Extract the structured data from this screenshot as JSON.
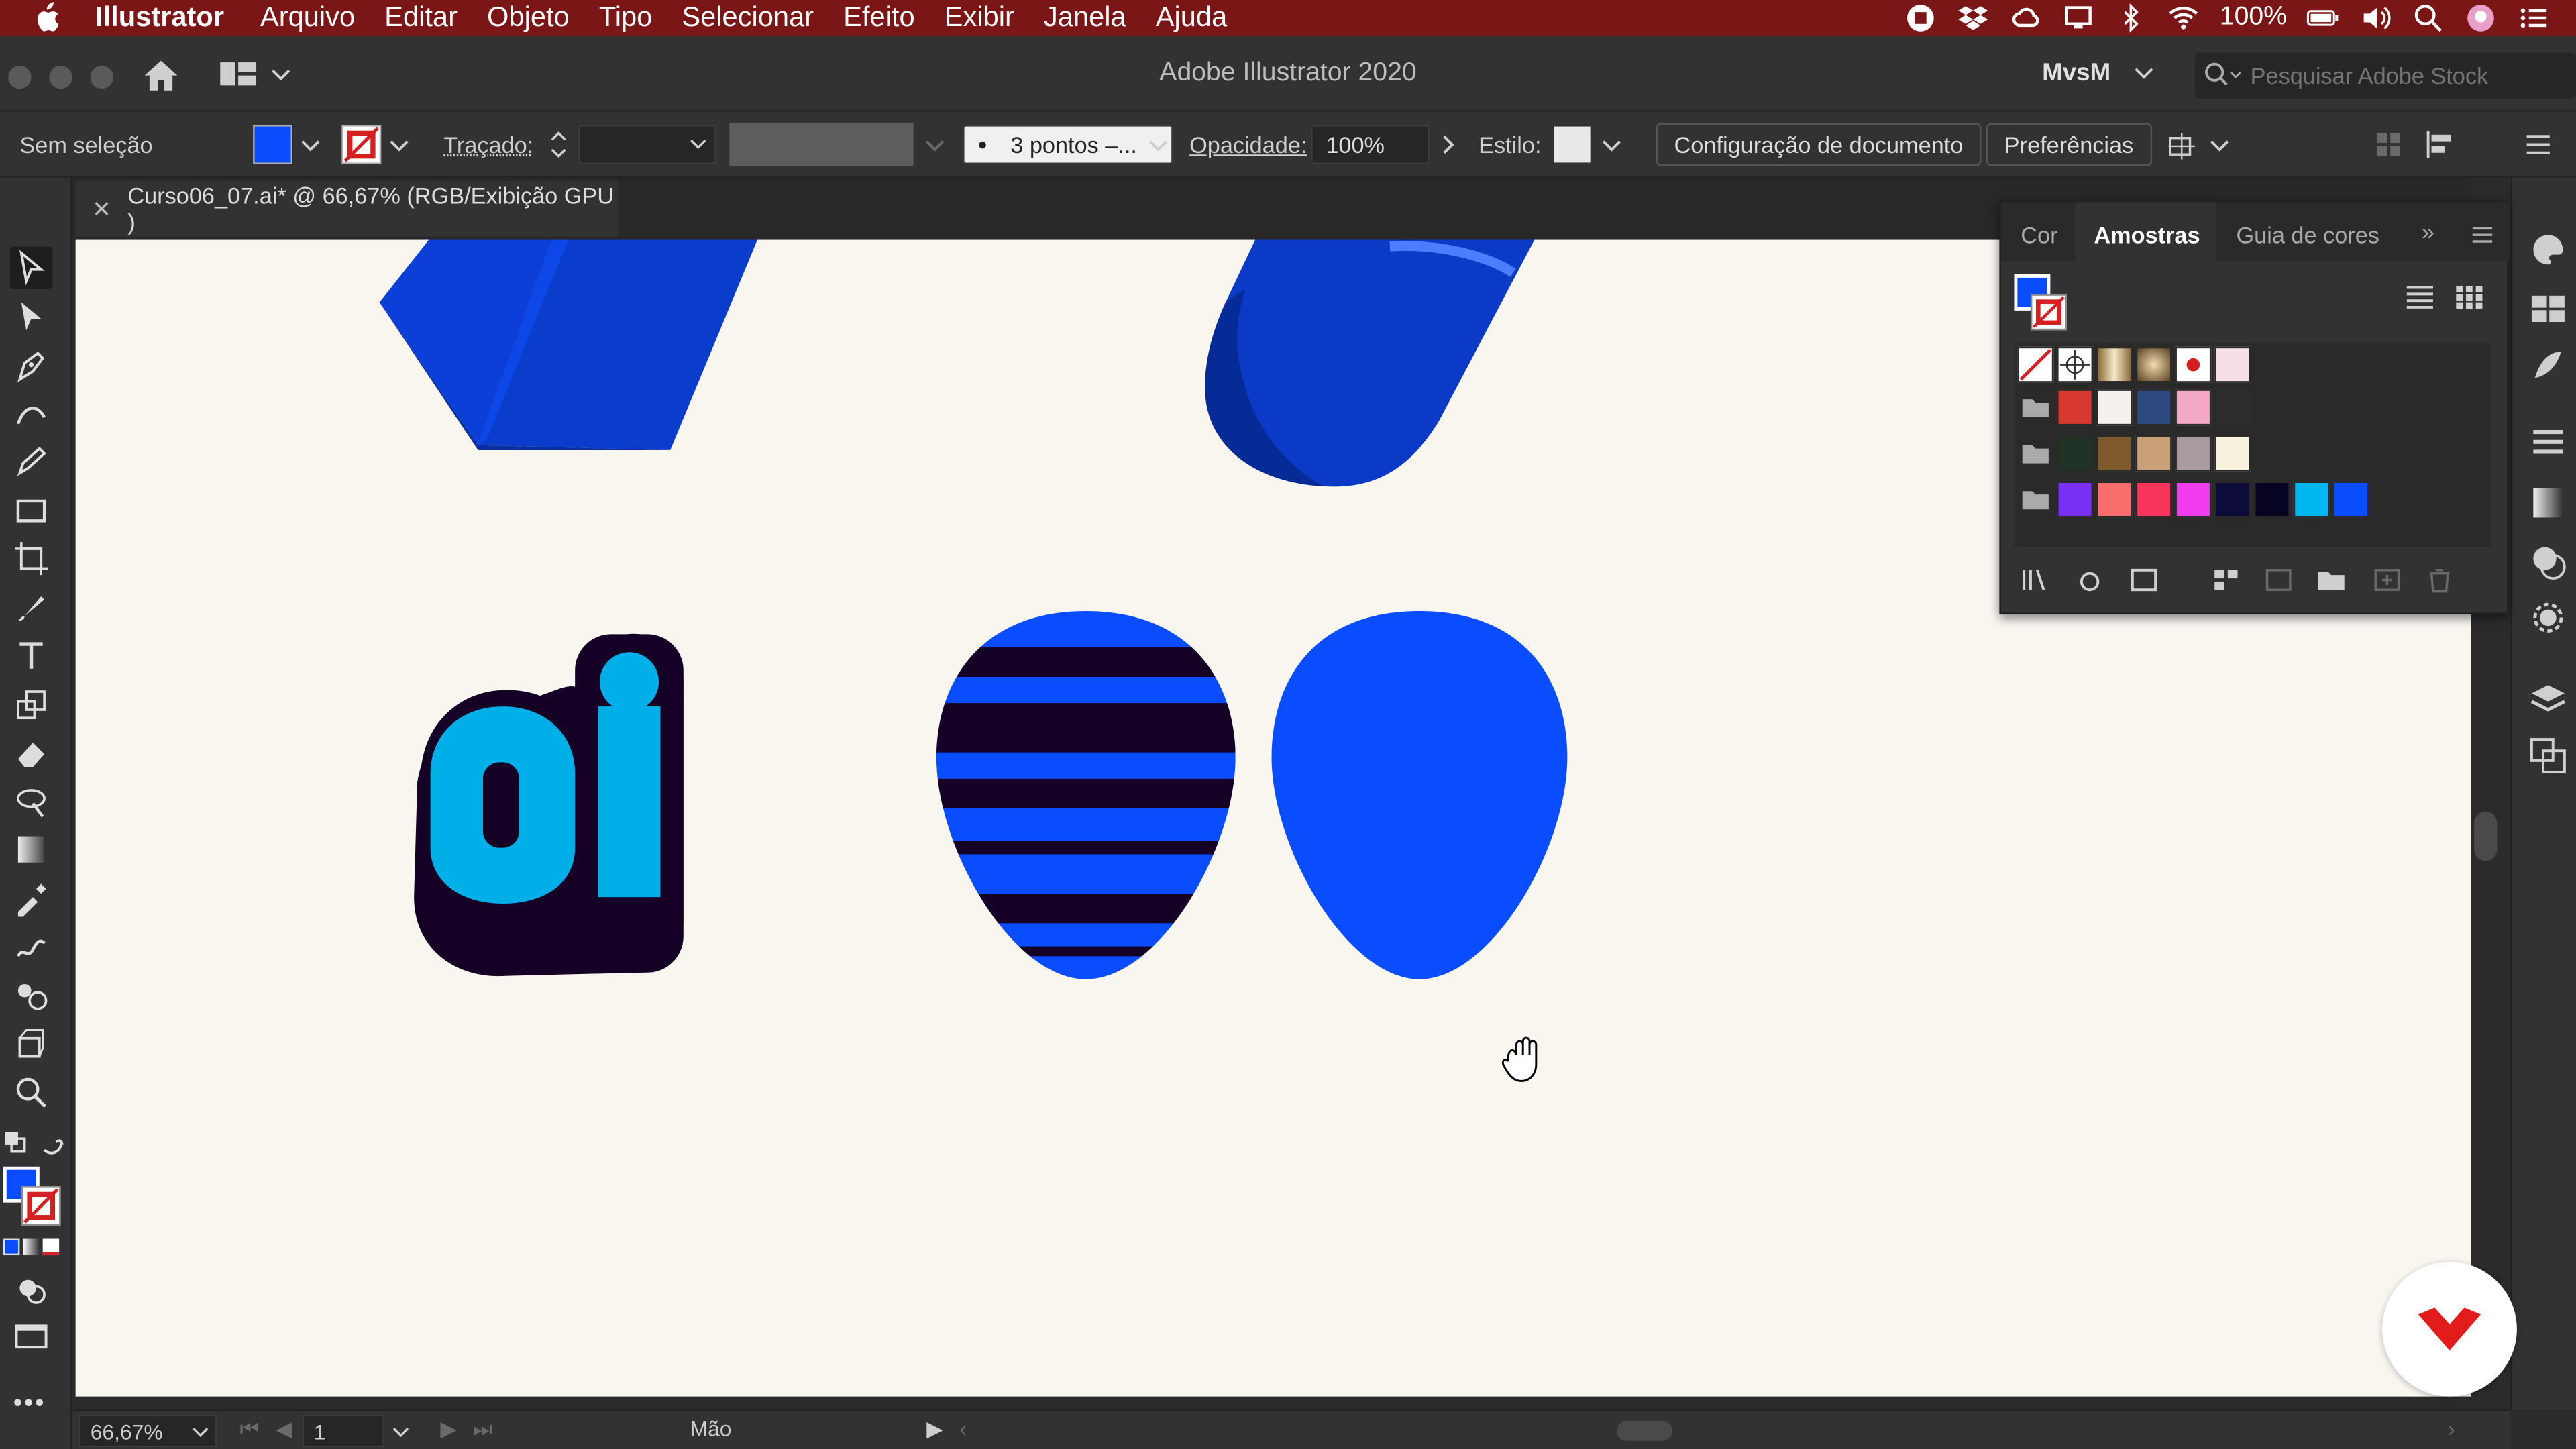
{
  "menubar": {
    "app_name": "Illustrator",
    "items": [
      "Arquivo",
      "Editar",
      "Objeto",
      "Tipo",
      "Selecionar",
      "Efeito",
      "Exibir",
      "Janela",
      "Ajuda"
    ],
    "battery": "100%"
  },
  "titlebar": {
    "title": "Adobe Illustrator 2020",
    "workspace": "MvsM",
    "stock_search_placeholder": "Pesquisar Adobe Stock"
  },
  "controlbar": {
    "selection_label": "Sem seleção",
    "stroke_label": "Traçado:",
    "brush_value": "3 pontos –...",
    "opacity_label": "Opacidade:",
    "opacity_value": "100%",
    "style_label": "Estilo:",
    "doc_setup_button": "Configuração de documento",
    "prefs_button": "Preferências",
    "fill_color": "#0a4cff"
  },
  "document": {
    "tab_title": "Curso06_07.ai* @ 66,67% (RGB/Exibição GPU )"
  },
  "swatches_panel": {
    "tabs": [
      "Cor",
      "Amostras",
      "Guia de cores"
    ],
    "active_tab": "Amostras",
    "row1": [
      "none",
      "registration",
      "gold-gradient",
      "radial-gradient",
      "dot-pattern",
      "pink-pattern"
    ],
    "group1": [
      "#d8392f",
      "#f4f1ec",
      "#2c4a80",
      "#f2a9c8",
      "#2e2e2e"
    ],
    "group2": [
      "#213226",
      "#7f5a2c",
      "#c9a078",
      "#a99aa2",
      "#f8f1dd"
    ],
    "group3": [
      "#7a2ff5",
      "#f96d6d",
      "#f9355b",
      "#f23cf0",
      "#0d0b3a",
      "#060422",
      "#00b7f0",
      "#0a4cff"
    ]
  },
  "statusbar": {
    "zoom": "66,67%",
    "page": "1",
    "tool_name": "Mão"
  },
  "colors": {
    "menubar": "#7a1616",
    "canvas": "#f9f6f0",
    "blue": "#0a4cff",
    "dark_navy": "#150026",
    "cyan": "#00aee8"
  }
}
